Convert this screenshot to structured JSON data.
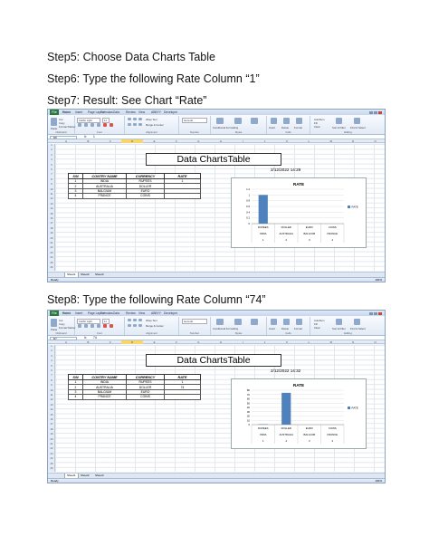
{
  "steps": {
    "step5": "Step5: Choose Data Charts Table",
    "step6": "Step6: Type the following Rate Column “1”",
    "step7": "Step7: Result: See Chart “Rate”",
    "step8": "Step8: Type the following Rate Column “74”"
  },
  "excel": {
    "file_tab": "File",
    "ribbon_tabs": [
      "Home",
      "Insert",
      "Page Layout",
      "Formulas",
      "Data",
      "Review",
      "View",
      "ABBYY",
      "Developer"
    ],
    "font_name": "Calibri Light",
    "font_size": "11",
    "number_format": "General",
    "groups": [
      "Clipboard",
      "Font",
      "Alignment",
      "Number",
      "Styles",
      "Cells",
      "Editing"
    ],
    "wrap_text": "Wrap Text",
    "merge_center": "Merge & Center",
    "conditional_formatting": "Conditional Formatting",
    "format_as_table": "Format as Table",
    "cell_styles": "Cell Styles",
    "insert": "Insert",
    "delete": "Delete",
    "format": "Format",
    "autosum": "AutoSum",
    "fill": "Fill",
    "clear": "Clear",
    "sort_filter": "Sort & Filter",
    "find_select": "Find & Select",
    "paste": "Paste",
    "cut": "Cut",
    "copy": "Copy",
    "format_painter": "Format Painter",
    "fx": "fx",
    "columns": [
      "A",
      "B",
      "C",
      "D",
      "E",
      "F",
      "G",
      "H",
      "I",
      "J",
      "K",
      "L",
      "M",
      "N",
      "O"
    ],
    "status_ready": "Ready",
    "zoom": "100%",
    "sheet_tabs": [
      "Sheet1",
      "Sheet2",
      "Sheet3"
    ],
    "table_title": "Data ChartsTable",
    "timestamp1": "2/12/2022 14:29",
    "timestamp2": "2/12/2022 14:32",
    "table_headers": [
      "S/N",
      "CONTRY NAME",
      "CURRENCY",
      "RATE"
    ]
  },
  "screenshot1": {
    "name_box": "D6",
    "formula_value": "1",
    "rows": [
      [
        "1",
        "INDIA",
        "RUPEES",
        "1"
      ],
      [
        "2",
        "AUSTRALIA",
        "DOLLER",
        ""
      ],
      [
        "3",
        "BALGIUM",
        "EURO",
        ""
      ],
      [
        "4",
        "FRANCE",
        "COINS",
        ""
      ]
    ]
  },
  "screenshot2": {
    "name_box": "D7",
    "formula_value": "74",
    "rows": [
      [
        "1",
        "INDIA",
        "RUPEES",
        "1"
      ],
      [
        "2",
        "AUSTRALIA",
        "DOLLER",
        "74"
      ],
      [
        "3",
        "BALGIUM",
        "EURO",
        ""
      ],
      [
        "4",
        "FRANCE",
        "COINS",
        ""
      ]
    ]
  },
  "chart_data": [
    {
      "type": "bar",
      "title": "RATE",
      "categories": [
        "RUPEES|INDIA|1",
        "DOLLER|AUSTRALIA|2",
        "EURO|BALGIUM|3",
        "COINS|FRANCE|4"
      ],
      "category_rows": [
        [
          "RUPEES",
          "DOLLER",
          "EURO",
          "COINS"
        ],
        [
          "INDIA",
          "AUSTRALIA",
          "BALGIUM",
          "FRANCE"
        ],
        [
          "1",
          "2",
          "3",
          "4"
        ]
      ],
      "series": [
        {
          "name": "RATE",
          "values": [
            1,
            0,
            0,
            0
          ]
        }
      ],
      "yticks": [
        "0",
        "0.2",
        "0.4",
        "0.6",
        "0.8",
        "1",
        "1.2"
      ],
      "ylim": [
        0,
        1.2
      ],
      "legend": "right",
      "bar_color": "#4f81bd"
    },
    {
      "type": "bar",
      "title": "RATE",
      "categories": [
        "RUPEES|INDIA|1",
        "DOLLER|AUSTRALIA|2",
        "EURO|BALGIUM|3",
        "COINS|FRANCE|4"
      ],
      "category_rows": [
        [
          "RUPEES",
          "DOLLER",
          "EURO",
          "COINS"
        ],
        [
          "INDIA",
          "AUSTRALIA",
          "BALGIUM",
          "FRANCE"
        ],
        [
          "1",
          "2",
          "3",
          "4"
        ]
      ],
      "series": [
        {
          "name": "RATE",
          "values": [
            1,
            74,
            0,
            0
          ]
        }
      ],
      "yticks": [
        "0",
        "10",
        "20",
        "30",
        "40",
        "50",
        "60",
        "70",
        "80"
      ],
      "ylim": [
        0,
        80
      ],
      "legend": "right",
      "bar_color": "#4f81bd"
    }
  ]
}
